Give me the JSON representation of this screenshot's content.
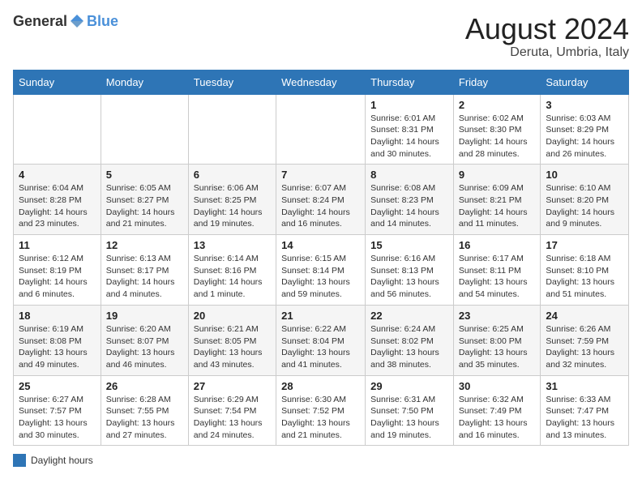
{
  "header": {
    "logo": {
      "general": "General",
      "blue": "Blue"
    },
    "title": "August 2024",
    "location": "Deruta, Umbria, Italy"
  },
  "days_of_week": [
    "Sunday",
    "Monday",
    "Tuesday",
    "Wednesday",
    "Thursday",
    "Friday",
    "Saturday"
  ],
  "weeks": [
    [
      {
        "day": "",
        "info": ""
      },
      {
        "day": "",
        "info": ""
      },
      {
        "day": "",
        "info": ""
      },
      {
        "day": "",
        "info": ""
      },
      {
        "day": "1",
        "info": "Sunrise: 6:01 AM\nSunset: 8:31 PM\nDaylight: 14 hours and 30 minutes."
      },
      {
        "day": "2",
        "info": "Sunrise: 6:02 AM\nSunset: 8:30 PM\nDaylight: 14 hours and 28 minutes."
      },
      {
        "day": "3",
        "info": "Sunrise: 6:03 AM\nSunset: 8:29 PM\nDaylight: 14 hours and 26 minutes."
      }
    ],
    [
      {
        "day": "4",
        "info": "Sunrise: 6:04 AM\nSunset: 8:28 PM\nDaylight: 14 hours and 23 minutes."
      },
      {
        "day": "5",
        "info": "Sunrise: 6:05 AM\nSunset: 8:27 PM\nDaylight: 14 hours and 21 minutes."
      },
      {
        "day": "6",
        "info": "Sunrise: 6:06 AM\nSunset: 8:25 PM\nDaylight: 14 hours and 19 minutes."
      },
      {
        "day": "7",
        "info": "Sunrise: 6:07 AM\nSunset: 8:24 PM\nDaylight: 14 hours and 16 minutes."
      },
      {
        "day": "8",
        "info": "Sunrise: 6:08 AM\nSunset: 8:23 PM\nDaylight: 14 hours and 14 minutes."
      },
      {
        "day": "9",
        "info": "Sunrise: 6:09 AM\nSunset: 8:21 PM\nDaylight: 14 hours and 11 minutes."
      },
      {
        "day": "10",
        "info": "Sunrise: 6:10 AM\nSunset: 8:20 PM\nDaylight: 14 hours and 9 minutes."
      }
    ],
    [
      {
        "day": "11",
        "info": "Sunrise: 6:12 AM\nSunset: 8:19 PM\nDaylight: 14 hours and 6 minutes."
      },
      {
        "day": "12",
        "info": "Sunrise: 6:13 AM\nSunset: 8:17 PM\nDaylight: 14 hours and 4 minutes."
      },
      {
        "day": "13",
        "info": "Sunrise: 6:14 AM\nSunset: 8:16 PM\nDaylight: 14 hours and 1 minute."
      },
      {
        "day": "14",
        "info": "Sunrise: 6:15 AM\nSunset: 8:14 PM\nDaylight: 13 hours and 59 minutes."
      },
      {
        "day": "15",
        "info": "Sunrise: 6:16 AM\nSunset: 8:13 PM\nDaylight: 13 hours and 56 minutes."
      },
      {
        "day": "16",
        "info": "Sunrise: 6:17 AM\nSunset: 8:11 PM\nDaylight: 13 hours and 54 minutes."
      },
      {
        "day": "17",
        "info": "Sunrise: 6:18 AM\nSunset: 8:10 PM\nDaylight: 13 hours and 51 minutes."
      }
    ],
    [
      {
        "day": "18",
        "info": "Sunrise: 6:19 AM\nSunset: 8:08 PM\nDaylight: 13 hours and 49 minutes."
      },
      {
        "day": "19",
        "info": "Sunrise: 6:20 AM\nSunset: 8:07 PM\nDaylight: 13 hours and 46 minutes."
      },
      {
        "day": "20",
        "info": "Sunrise: 6:21 AM\nSunset: 8:05 PM\nDaylight: 13 hours and 43 minutes."
      },
      {
        "day": "21",
        "info": "Sunrise: 6:22 AM\nSunset: 8:04 PM\nDaylight: 13 hours and 41 minutes."
      },
      {
        "day": "22",
        "info": "Sunrise: 6:24 AM\nSunset: 8:02 PM\nDaylight: 13 hours and 38 minutes."
      },
      {
        "day": "23",
        "info": "Sunrise: 6:25 AM\nSunset: 8:00 PM\nDaylight: 13 hours and 35 minutes."
      },
      {
        "day": "24",
        "info": "Sunrise: 6:26 AM\nSunset: 7:59 PM\nDaylight: 13 hours and 32 minutes."
      }
    ],
    [
      {
        "day": "25",
        "info": "Sunrise: 6:27 AM\nSunset: 7:57 PM\nDaylight: 13 hours and 30 minutes."
      },
      {
        "day": "26",
        "info": "Sunrise: 6:28 AM\nSunset: 7:55 PM\nDaylight: 13 hours and 27 minutes."
      },
      {
        "day": "27",
        "info": "Sunrise: 6:29 AM\nSunset: 7:54 PM\nDaylight: 13 hours and 24 minutes."
      },
      {
        "day": "28",
        "info": "Sunrise: 6:30 AM\nSunset: 7:52 PM\nDaylight: 13 hours and 21 minutes."
      },
      {
        "day": "29",
        "info": "Sunrise: 6:31 AM\nSunset: 7:50 PM\nDaylight: 13 hours and 19 minutes."
      },
      {
        "day": "30",
        "info": "Sunrise: 6:32 AM\nSunset: 7:49 PM\nDaylight: 13 hours and 16 minutes."
      },
      {
        "day": "31",
        "info": "Sunrise: 6:33 AM\nSunset: 7:47 PM\nDaylight: 13 hours and 13 minutes."
      }
    ]
  ],
  "legend": {
    "label": "Daylight hours"
  }
}
